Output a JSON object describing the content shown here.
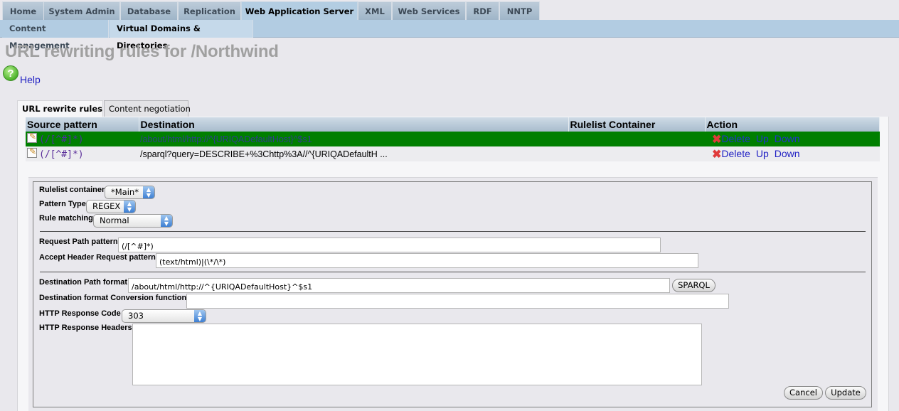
{
  "nav": {
    "tabs": [
      {
        "label": "Home"
      },
      {
        "label": "System Admin"
      },
      {
        "label": "Database"
      },
      {
        "label": "Replication"
      },
      {
        "label": "Web Application Server",
        "active": true
      },
      {
        "label": "XML"
      },
      {
        "label": "Web Services"
      },
      {
        "label": "RDF"
      },
      {
        "label": "NNTP"
      }
    ],
    "subtabs": [
      {
        "label": "Content Management"
      },
      {
        "label": "Virtual Domains & Directories",
        "active": true
      }
    ]
  },
  "page": {
    "title": "URL rewriting rules for /Northwind",
    "help_label": "Help",
    "help_icon": "?"
  },
  "tabs": {
    "rewrite_rules": "URL rewrite rules",
    "content_negotiation": "Content negotiation"
  },
  "rules_table": {
    "headers": [
      "Source pattern",
      "Destination",
      "Rulelist Container",
      "Action"
    ],
    "rows": [
      {
        "source": "(/[^#]*)",
        "destination": "/about/html/http://^{URIQADefaultHost}^$s1",
        "container": "",
        "actions": [
          "Delete",
          "Up",
          "Down"
        ],
        "selected": true
      },
      {
        "source": "(/[^#]*)",
        "destination": "/sparql?query=DESCRIBE+%3Chttp%3A//^{URIQADefaultH ...",
        "container": "",
        "actions": [
          "Delete",
          "Up",
          "Down"
        ],
        "selected": false
      }
    ],
    "selected_row_color": "#007f00"
  },
  "form": {
    "rulelist_container": {
      "label": "Rulelist container",
      "value": "*Main*"
    },
    "pattern_type": {
      "label": "Pattern Type",
      "value": "REGEX"
    },
    "rule_matching": {
      "label": "Rule matching",
      "value": "Normal"
    },
    "request_path_pattern": {
      "label": "Request Path pattern",
      "value": "(/[^#]*)"
    },
    "accept_header_pattern": {
      "label": "Accept Header Request pattern",
      "value": "(text/html)|(\\*/\\*)"
    },
    "destination_path_format": {
      "label": "Destination Path format",
      "value": "/about/html/http://^{URIQADefaultHost}^$s1"
    },
    "sparql_button": "SPARQL",
    "destination_conversion_function": {
      "label": "Destination format Conversion function",
      "value": ""
    },
    "http_response_code": {
      "label": "HTTP Response Code",
      "value": "303"
    },
    "http_response_headers": {
      "label": "HTTP Response Headers",
      "value": ""
    },
    "cancel_button": "Cancel",
    "update_button": "Update"
  }
}
